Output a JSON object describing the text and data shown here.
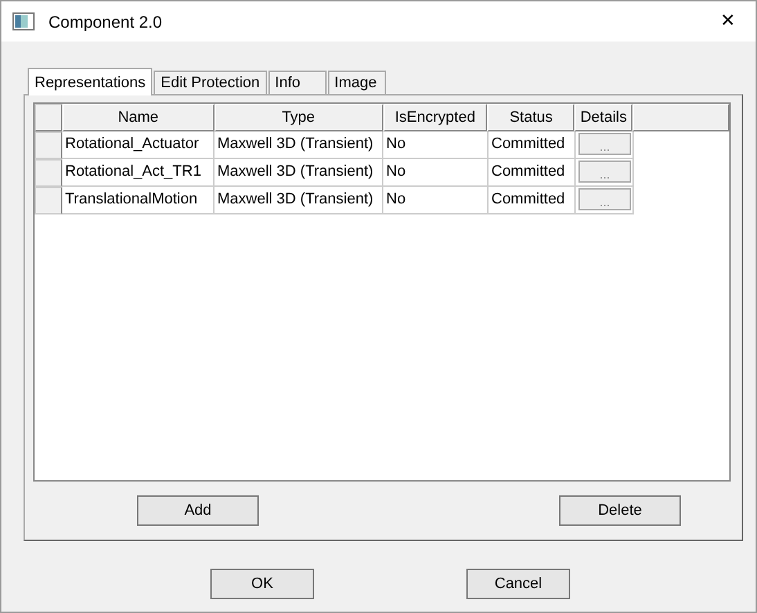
{
  "window": {
    "title": "Component 2.0",
    "close": "✕"
  },
  "tabs": [
    {
      "label": "Representations",
      "selected": true
    },
    {
      "label": "Edit Protection",
      "selected": false
    },
    {
      "label": "Info",
      "selected": false
    },
    {
      "label": "Image",
      "selected": false
    }
  ],
  "table": {
    "columns": [
      "Name",
      "Type",
      "IsEncrypted",
      "Status",
      "Details"
    ],
    "rows": [
      {
        "name": "Rotational_Actuator",
        "type": "Maxwell 3D (Transient)",
        "encrypted": "No",
        "status": "Committed",
        "details": "..."
      },
      {
        "name": "Rotational_Act_TR1",
        "type": "Maxwell 3D (Transient)",
        "encrypted": "No",
        "status": "Committed",
        "details": "..."
      },
      {
        "name": "TranslationalMotion",
        "type": "Maxwell 3D (Transient)",
        "encrypted": "No",
        "status": "Committed",
        "details": "..."
      }
    ]
  },
  "panel_buttons": [
    "Add",
    "Delete"
  ],
  "buttons": [
    "OK",
    "Cancel"
  ]
}
